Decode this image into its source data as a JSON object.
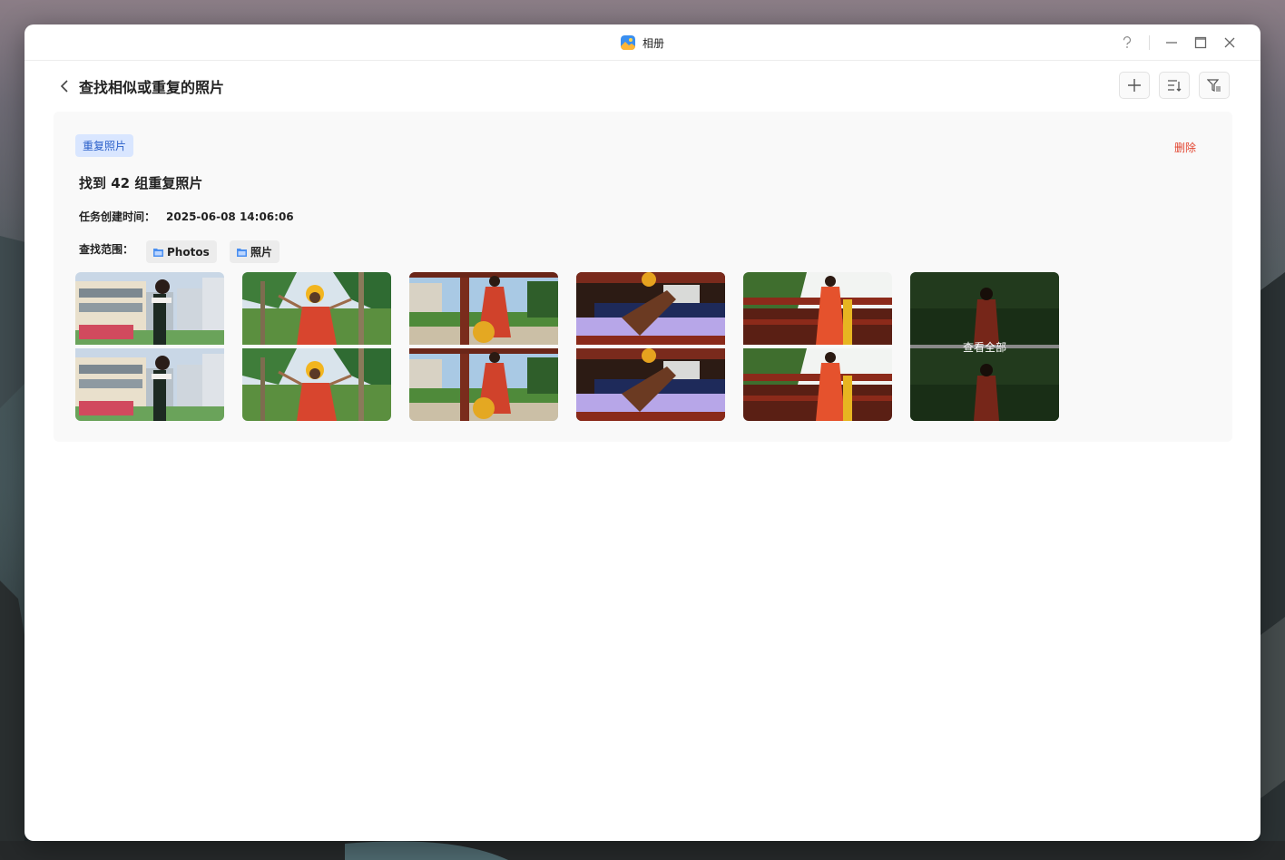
{
  "window": {
    "app_title": "相册"
  },
  "header": {
    "title": "查找相似或重复的照片"
  },
  "card": {
    "badge": "重复照片",
    "delete_label": "删除",
    "found_text": "找到 42 组重复照片",
    "created_label": "任务创建时间：",
    "created_value": "2025-06-08 14:06:06",
    "scope_label": "查找范围：",
    "scope_folders": [
      "Photos",
      "照片"
    ],
    "view_all_label": "查看全部"
  },
  "icons": {
    "help": "help-icon",
    "minimize": "minimize-icon",
    "maximize": "maximize-icon",
    "close": "close-icon",
    "back": "chevron-left-icon",
    "add": "plus-icon",
    "sort": "sort-icon",
    "filter": "filter-icon",
    "folder": "folder-icon"
  },
  "colors": {
    "badge_bg": "#d9e6ff",
    "badge_text": "#2a5fc9",
    "delete_text": "#e2442f",
    "card_bg": "#f9f9f9"
  }
}
